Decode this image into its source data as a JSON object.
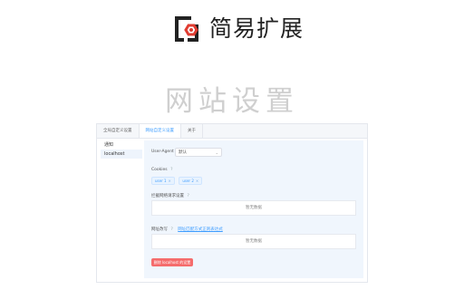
{
  "header": {
    "app_title": "简易扩展",
    "page_title": "网站设置",
    "logo_color": "#e03c31"
  },
  "tabs": [
    {
      "label": "全局自定义设置"
    },
    {
      "label": "网站自定义设置"
    },
    {
      "label": "关于"
    }
  ],
  "sidebar": {
    "items": [
      {
        "label": "通知"
      },
      {
        "label": "localhost"
      }
    ]
  },
  "form": {
    "user_agent_label": "User-Agent",
    "user_agent_value": "默认",
    "cookies_label": "Cookies",
    "cookies": [
      {
        "label": "user 1",
        "close": "×"
      },
      {
        "label": "user 2",
        "close": "×"
      }
    ],
    "block_requests_label": "拦截网络请求设置",
    "block_requests_empty": "暂无数据",
    "rules_label": "网址改写",
    "rules_link": "网址匹配方式正则表达式",
    "rules_empty": "暂无数据",
    "delete_button": "删除 localhost 的设置"
  },
  "help_icon": "?"
}
